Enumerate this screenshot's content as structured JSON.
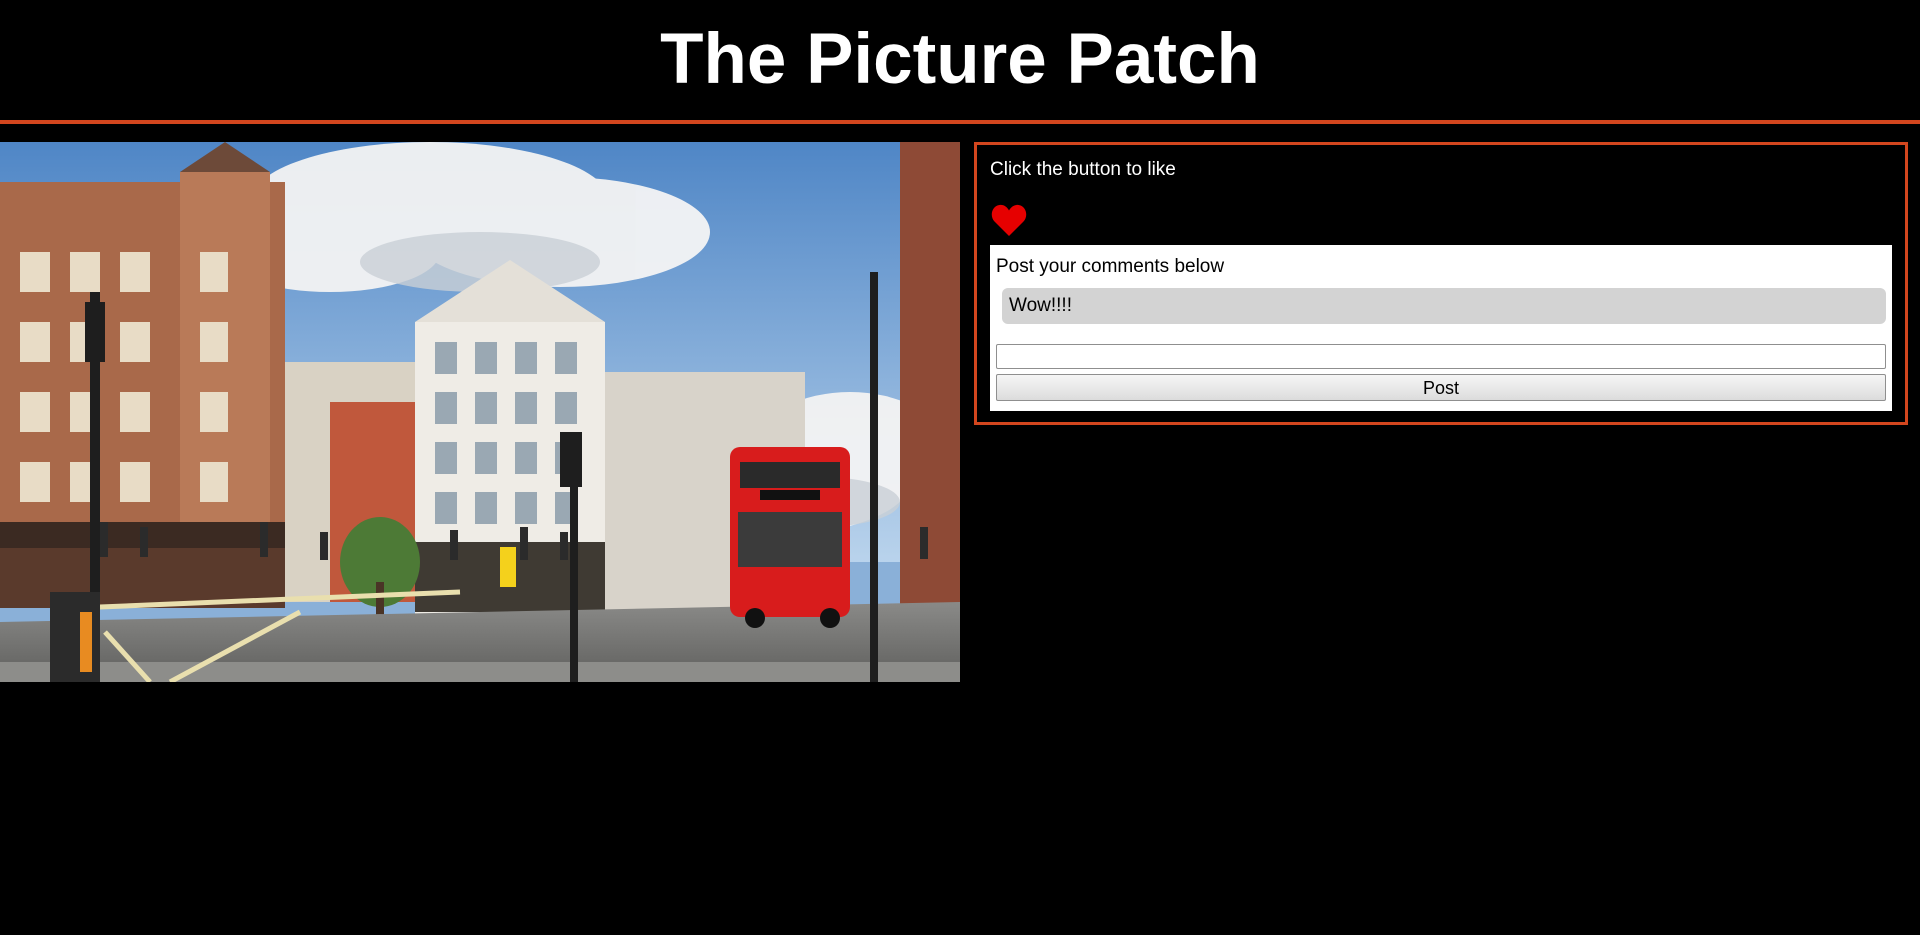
{
  "header": {
    "title": "The Picture Patch"
  },
  "photo": {
    "subject": "london-street-scene-image"
  },
  "like_panel": {
    "prompt": "Click the button to like",
    "like_icon": "heart-icon",
    "like_color": "#e60000"
  },
  "comments": {
    "heading": "Post your comments below",
    "items": [
      "Wow!!!!"
    ],
    "input_value": "",
    "post_label": "Post"
  },
  "colors": {
    "background": "#000000",
    "accent_border": "#d2461e",
    "comment_bubble": "#d3d3d3"
  }
}
